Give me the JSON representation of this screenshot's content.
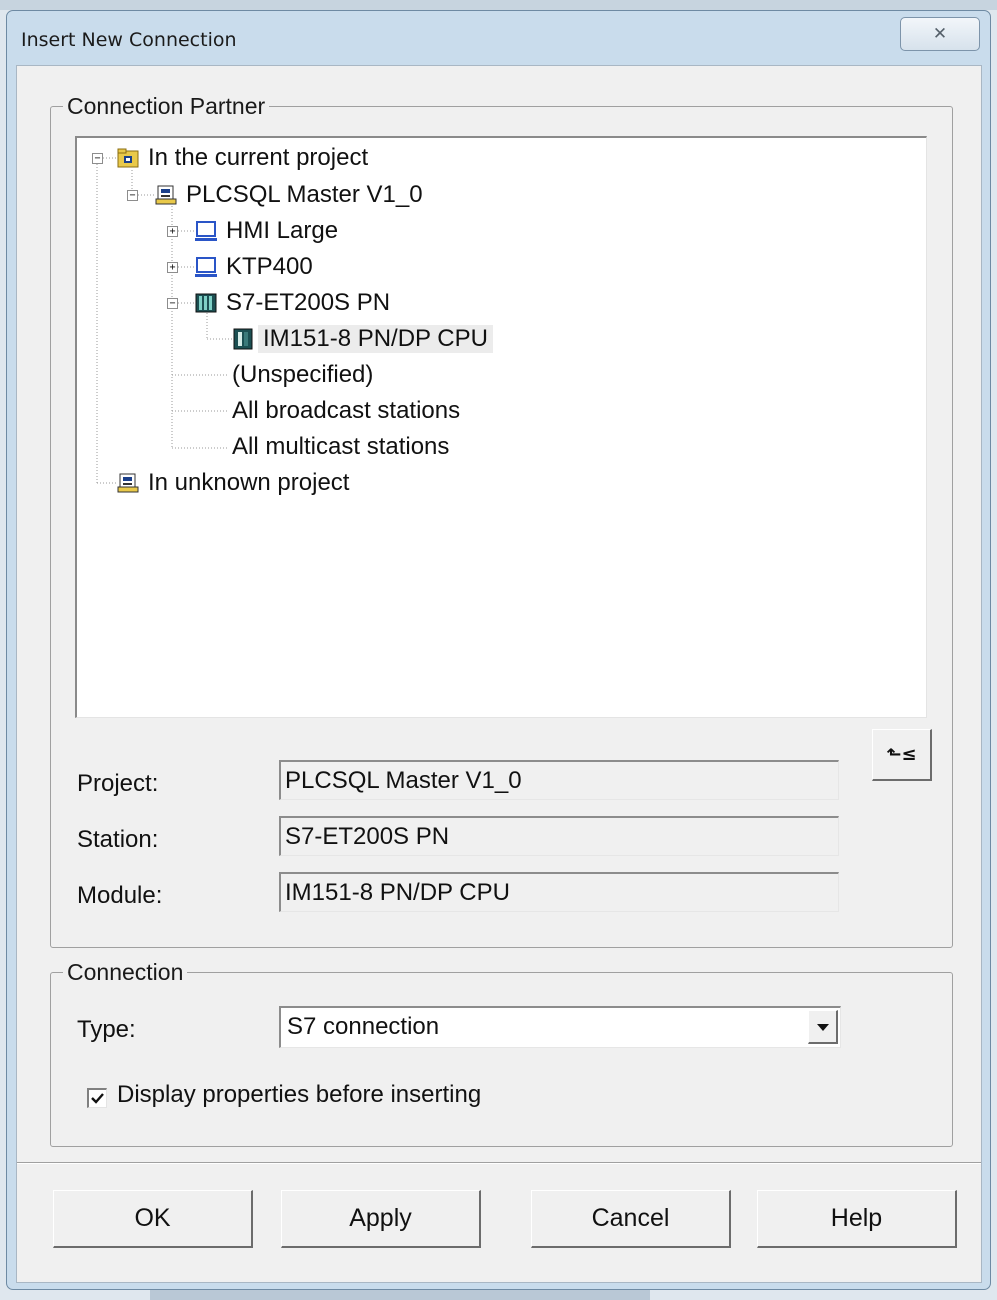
{
  "dialog": {
    "title": "Insert New Connection",
    "close_glyph": "✕"
  },
  "partner": {
    "legend": "Connection Partner",
    "tree": {
      "current_project": "In the current project",
      "plc_master": "PLCSQL Master V1_0",
      "hmi_large": "HMI Large",
      "ktp400": "KTP400",
      "et200s": "S7-ET200S PN",
      "im151": "IM151-8 PN/DP CPU",
      "unspecified": "(Unspecified)",
      "broadcast": "All broadcast stations",
      "multicast": "All multicast stations",
      "unknown_project": "In unknown project"
    },
    "project_label": "Project:",
    "project_value": "PLCSQL Master V1_0",
    "station_label": "Station:",
    "station_value": "S7-ET200S PN",
    "module_label": "Module:",
    "module_value": "IM151-8 PN/DP CPU",
    "goto_glyph": "⬑≤"
  },
  "connection": {
    "legend": "Connection",
    "type_label": "Type:",
    "type_value": "S7 connection",
    "display_props_label": "Display properties before inserting",
    "display_props_checked": true
  },
  "buttons": {
    "ok": "OK",
    "apply": "Apply",
    "cancel": "Cancel",
    "help": "Help"
  }
}
